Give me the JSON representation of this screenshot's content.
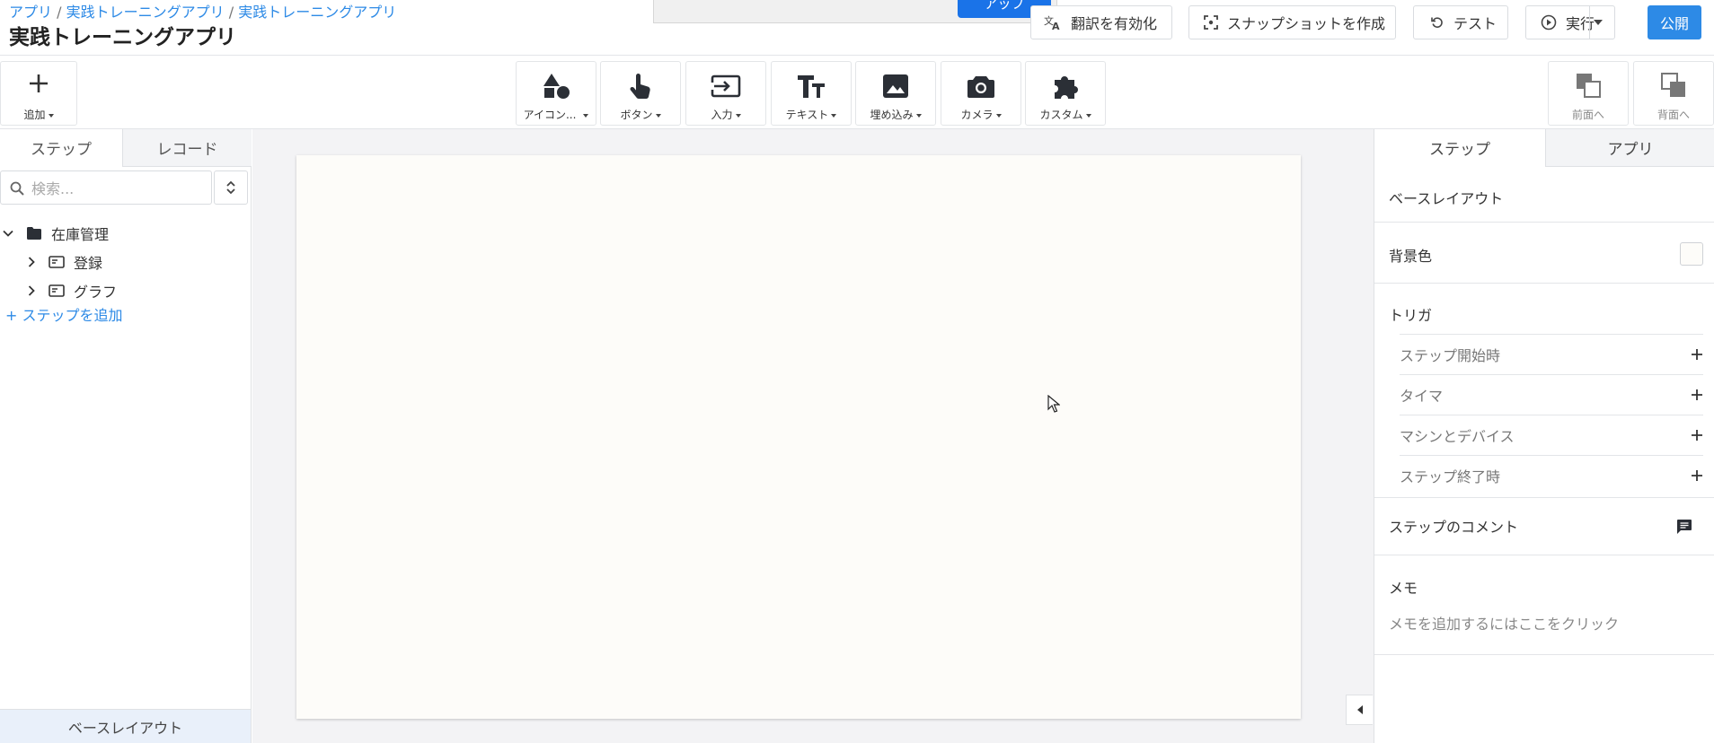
{
  "header": {
    "breadcrumb": [
      "アプリ",
      "実践トレーニングアプリ",
      "実践トレーニングアプリ"
    ],
    "breadcrumb_sep": "/",
    "title": "実践トレーニングアプリ",
    "toast_button": "アップ",
    "buttons": {
      "translate": "翻訳を有効化",
      "snapshot": "スナップショットを作成",
      "test": "テスト",
      "run": "実行",
      "publish": "公開"
    }
  },
  "toolbar": {
    "add": "追加",
    "tools": [
      {
        "label": "アイコン...",
        "icon": "shapes-icon"
      },
      {
        "label": "ボタン",
        "icon": "pointer-hand-icon"
      },
      {
        "label": "入力",
        "icon": "input-icon"
      },
      {
        "label": "テキスト",
        "icon": "text-icon"
      },
      {
        "label": "埋め込み",
        "icon": "image-icon"
      },
      {
        "label": "カメラ",
        "icon": "camera-icon"
      },
      {
        "label": "カスタム",
        "icon": "puzzle-icon"
      }
    ],
    "bring_forward": "前面へ",
    "send_backward": "背面へ"
  },
  "left_panel": {
    "tabs": [
      "ステップ",
      "レコード"
    ],
    "search_placeholder": "検索...",
    "tree": {
      "folder": "在庫管理",
      "children": [
        "登録",
        "グラフ"
      ]
    },
    "add_step": "ステップを追加",
    "footer": "ベースレイアウト"
  },
  "right_panel": {
    "tabs": [
      "ステップ",
      "アプリ"
    ],
    "base_layout": "ベースレイアウト",
    "background_color_label": "背景色",
    "background_color": "#fdfcf9",
    "triggers_title": "トリガ",
    "triggers": [
      "ステップ開始時",
      "タイマ",
      "マシンとデバイス",
      "ステップ終了時"
    ],
    "comments_title": "ステップのコメント",
    "memo_title": "メモ",
    "memo_hint": "メモを追加するにはここをクリック"
  },
  "colors": {
    "accent": "#2d8ae6",
    "canvas_bg": "#fdfcf9"
  }
}
